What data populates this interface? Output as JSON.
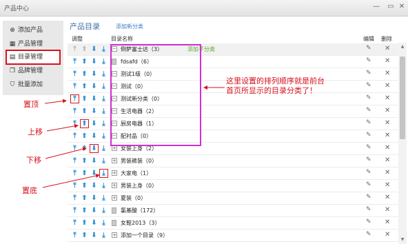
{
  "window": {
    "title": "产品中心"
  },
  "sidebar": {
    "items": [
      {
        "label": "添加产品",
        "icon": "plus-circle-icon",
        "glyph": "⊕"
      },
      {
        "label": "产品管理",
        "icon": "grid-icon",
        "glyph": "▦"
      },
      {
        "label": "目录管理",
        "icon": "folder-tree-icon",
        "glyph": "▤",
        "active": true
      },
      {
        "label": "品牌管理",
        "icon": "copy-icon",
        "glyph": "❐"
      },
      {
        "label": "批量添加",
        "icon": "shield-icon",
        "glyph": "⛉"
      }
    ]
  },
  "main": {
    "title": "产品目录",
    "new_category": "添加新分类"
  },
  "table": {
    "headers": {
      "adjust": "调整",
      "name": "目录名称",
      "edit": "编辑",
      "delete": "删除"
    },
    "add_sub": "添加子分类",
    "rows": [
      {
        "name": "倒萨富士达（3）",
        "expanded": true,
        "first": true
      },
      {
        "name": "fdsafd（6）",
        "doc": true
      },
      {
        "name": "测试1级（0）",
        "expanded": true
      },
      {
        "name": "测试（0）",
        "expanded": true
      },
      {
        "name": "测试新分类（0）",
        "expanded": true
      },
      {
        "name": "生活电器（2）",
        "expanded": true
      },
      {
        "name": "厨房电器（1）",
        "expanded": true
      },
      {
        "name": "配衬品（0）",
        "expanded": true
      },
      {
        "name": "女装上身（2）",
        "expanded": false
      },
      {
        "name": "男装裤装（0）",
        "expanded": false
      },
      {
        "name": "大家电（1）",
        "expanded": false
      },
      {
        "name": "男装上身（0）",
        "expanded": false
      },
      {
        "name": "夏装（0）",
        "expanded": false
      },
      {
        "name": "氯基酸（172）",
        "doc": true
      },
      {
        "name": "女鞋2013（3）",
        "doc": true
      },
      {
        "name": "添加一个目录（9）",
        "expanded": false
      }
    ]
  },
  "annotations": {
    "note": "这里设置的排列顺序就是前台首页所显示的目录分类了！",
    "top": "置顶",
    "up": "上移",
    "down": "下移",
    "bottom": "置底"
  }
}
